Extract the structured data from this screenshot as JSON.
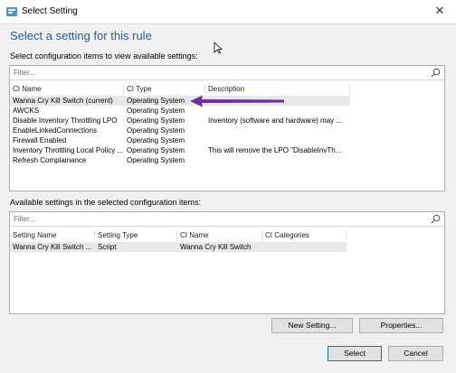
{
  "window": {
    "title": "Select Setting",
    "close_glyph": "✕"
  },
  "heading": "Select a setting for this rule",
  "top_section": {
    "label": "Select configuration items to view available settings:",
    "filter_placeholder": "Filter...",
    "columns": [
      "CI Name",
      "CI Type",
      "Description"
    ],
    "rows": [
      [
        "Wanna Cry Kill Switch (current)",
        "Operating System",
        ""
      ],
      [
        "AWCKS",
        "Operating System",
        ""
      ],
      [
        "Disable Inventory Throttling LPO",
        "Operating System",
        "Inventory (software and hardware) may ..."
      ],
      [
        "EnableLinkedConnections",
        "Operating System",
        ""
      ],
      [
        "Firewall Enabled",
        "Operating System",
        ""
      ],
      [
        "Inventory Throttling Local Policy ...",
        "Operating System",
        "This will remove the LPO \"DisableInvTh..."
      ],
      [
        "Refresh Complainance",
        "Operating System",
        ""
      ]
    ],
    "selected_row": 0
  },
  "bottom_section": {
    "label": "Available settings in the selected configuration items:",
    "filter_placeholder": "Filter...",
    "columns": [
      "Setting Name",
      "Setting Type",
      "CI Name",
      "CI Categories"
    ],
    "rows": [
      [
        "Wanna Cry Kill Switch ...",
        "Script",
        "Wanna Cry Kill Switch",
        ""
      ]
    ],
    "selected_row": 0
  },
  "buttons": {
    "new_setting": "New Setting...",
    "properties": "Properties...",
    "select": "Select",
    "cancel": "Cancel"
  },
  "colors": {
    "heading": "#1f5fa8",
    "arrow": "#6b2fa0",
    "accent": "#0078d7"
  }
}
